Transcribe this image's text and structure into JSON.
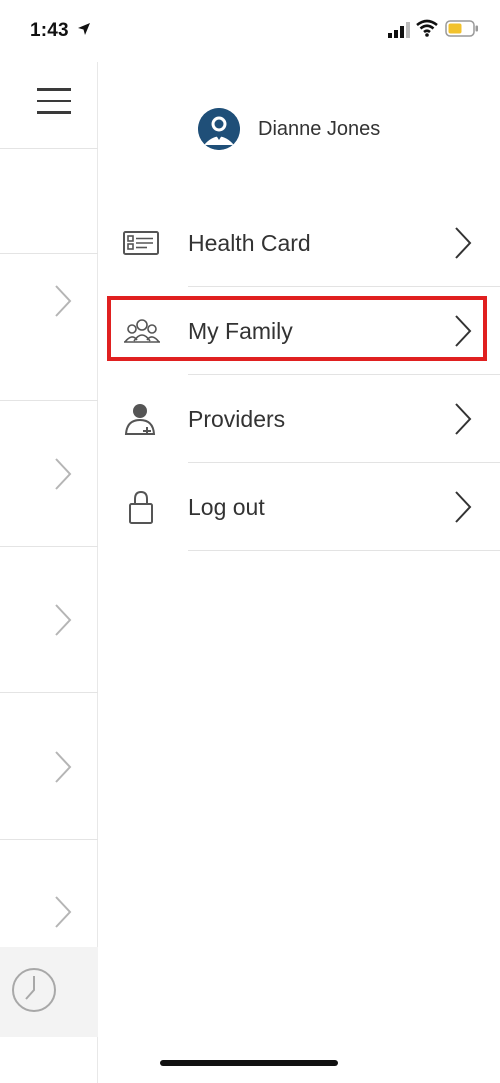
{
  "status_bar": {
    "time": "1:43",
    "battery_color": "#f2c22c"
  },
  "user": {
    "name": "Dianne Jones",
    "avatar_color": "#1f4f78"
  },
  "menu": {
    "items": [
      {
        "label": "Health Card",
        "icon": "id-card-icon"
      },
      {
        "label": "My Family",
        "icon": "family-icon",
        "highlighted": true
      },
      {
        "label": "Providers",
        "icon": "doctor-icon"
      },
      {
        "label": "Log out",
        "icon": "lock-icon"
      }
    ]
  },
  "colors": {
    "highlight": "#e02020",
    "text": "#333333",
    "divider": "#e3e3e3"
  }
}
